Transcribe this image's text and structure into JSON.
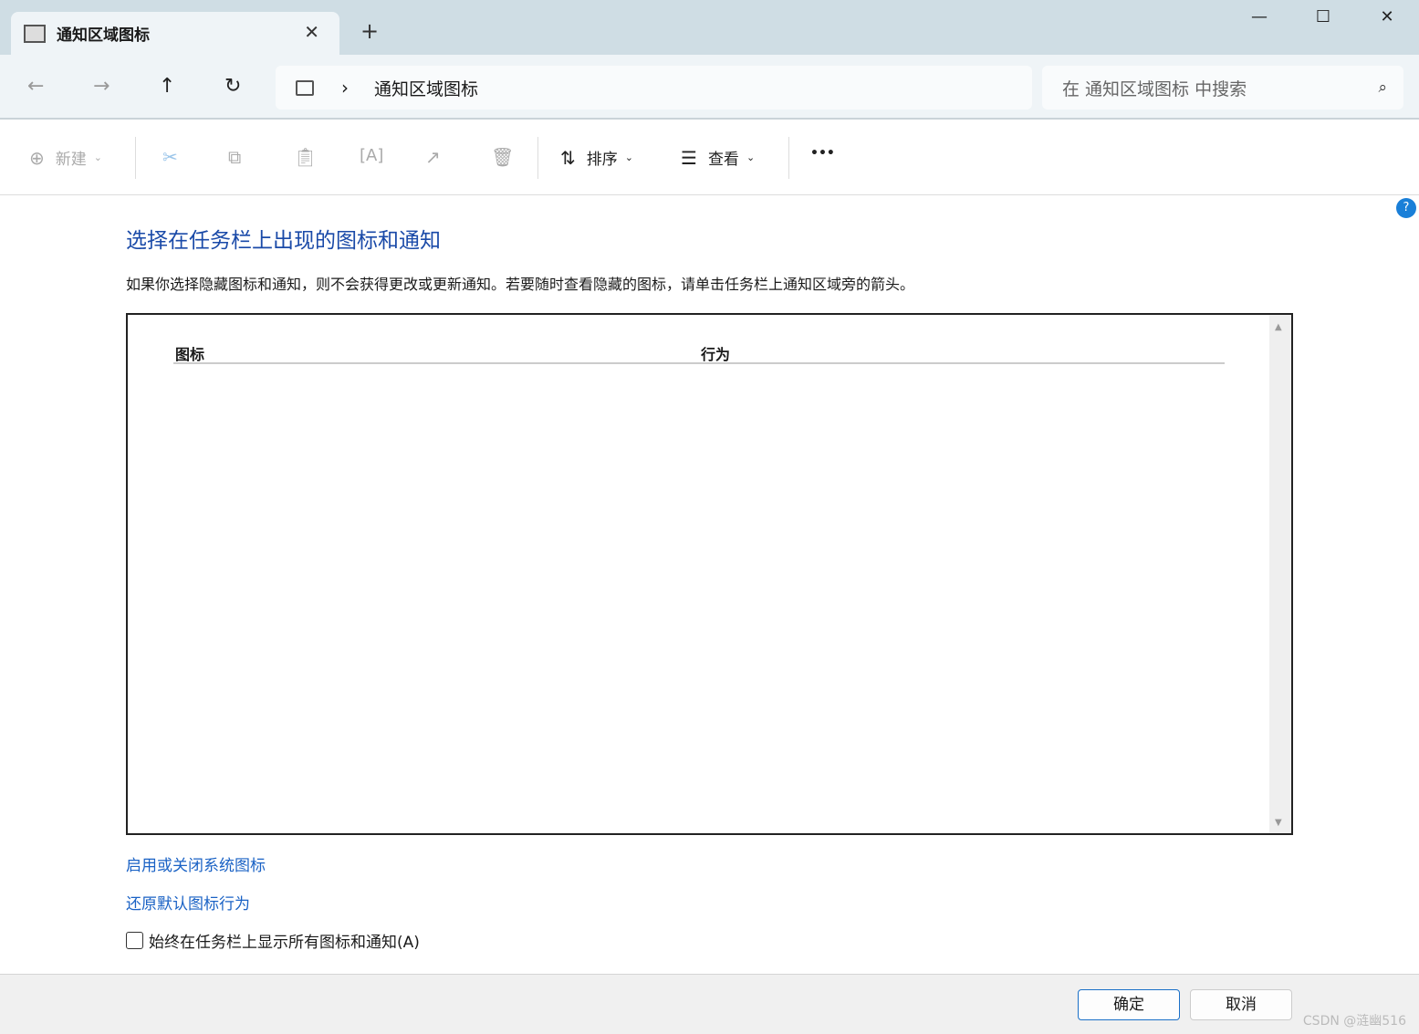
{
  "window": {
    "tab_title": "通知区域图标",
    "close_tab": "✕",
    "new_tab": "+",
    "minimize": "—",
    "maximize": "☐",
    "close": "✕"
  },
  "nav": {
    "back": "←",
    "forward": "→",
    "up": "↑",
    "refresh": "↻",
    "breadcrumb_sep": "›",
    "location": "通知区域图标",
    "search_placeholder": "在 通知区域图标 中搜索",
    "search_icon": "⌕"
  },
  "toolbar": {
    "new_label": "新建",
    "sort_label": "排序",
    "view_label": "查看",
    "more": "•••"
  },
  "main": {
    "title": "选择在任务栏上出现的图标和通知",
    "description": "如果你选择隐藏图标和通知，则不会获得更改或更新通知。若要随时查看隐藏的图标，请单击任务栏上通知区域旁的箭头。",
    "columns": [
      "图标",
      "行为"
    ],
    "link_system_icons": "启用或关闭系统图标",
    "link_restore": "还原默认图标行为",
    "checkbox_label": "始终在任务栏上显示所有图标和通知(A)",
    "checkbox_checked": false,
    "help": "?"
  },
  "footer": {
    "ok": "确定",
    "cancel": "取消",
    "watermark": "CSDN @涟幽516"
  }
}
